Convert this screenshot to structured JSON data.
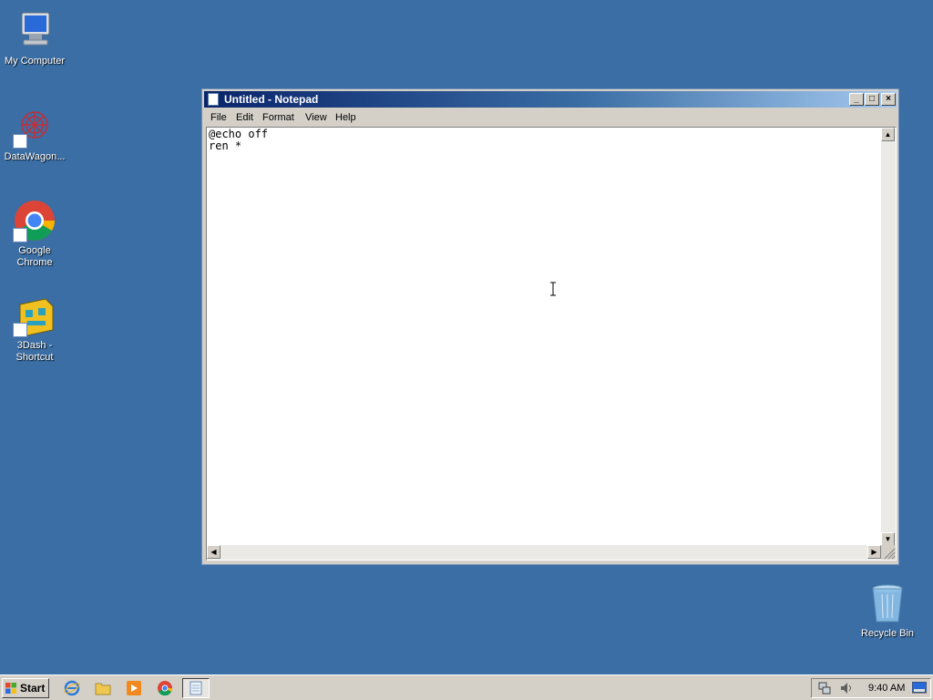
{
  "desktop": {
    "icons": [
      {
        "label": "My Computer",
        "icon": "my-computer-icon"
      },
      {
        "label": "DataWagon...",
        "icon": "datawagon-icon"
      },
      {
        "label": "Google Chrome",
        "icon": "chrome-icon"
      },
      {
        "label": "3Dash - Shortcut",
        "icon": "3dash-icon"
      },
      {
        "label": "Recycle Bin",
        "icon": "recycle-bin-icon"
      }
    ]
  },
  "notepad": {
    "title": "Untitled - Notepad",
    "menu": [
      "File",
      "Edit",
      "Format",
      "View",
      "Help"
    ],
    "lines": [
      "@echo off",
      "ren *"
    ]
  },
  "taskbar": {
    "start_label": "Start",
    "clock": "9:40 AM"
  },
  "colors": {
    "desktop": "#3a6ea5",
    "titlebar_start": "#0a246a",
    "titlebar_end": "#a6caf0"
  }
}
